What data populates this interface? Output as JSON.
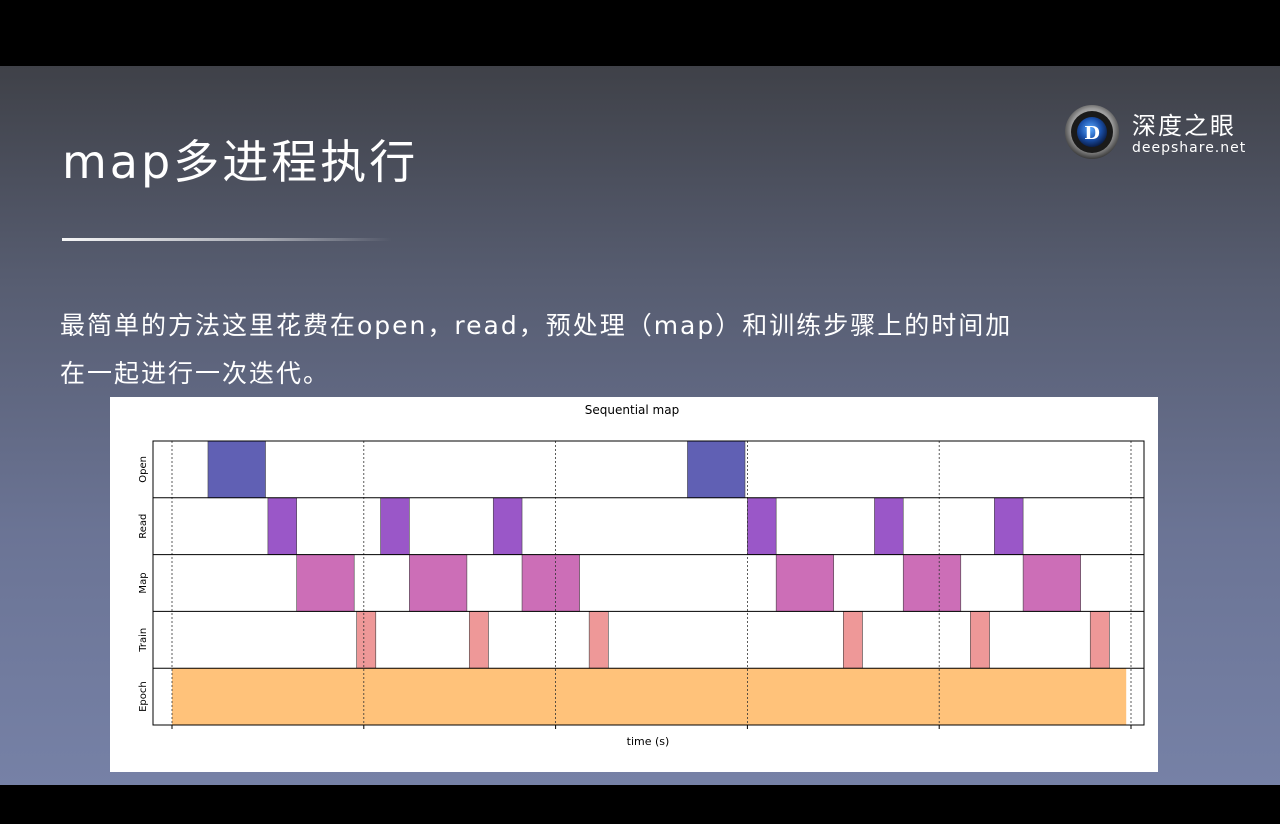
{
  "slide": {
    "title": "map多进程执行",
    "paragraph_line1": "最简单的方法这里花费在open，read，预处理（map）和训练步骤上的时间加",
    "paragraph_line2": "在一起进行一次迭代。"
  },
  "logo": {
    "name_cn": "深度之眼",
    "name_en": "deepshare.net",
    "mark_letter": "D"
  },
  "colors": {
    "open": "#6060b4",
    "read": "#9a57c8",
    "map": "#cc6eb7",
    "train": "#ee9898",
    "epoch": "#ffc27a"
  },
  "chart_data": {
    "type": "timeline",
    "title": "Sequential map",
    "xlabel": "time (s)",
    "ylabel": "",
    "rows": [
      "Open",
      "Read",
      "Map",
      "Train",
      "Epoch"
    ],
    "xlim": [
      0,
      20.3
    ],
    "gridlines": [
      0,
      4,
      8,
      12,
      16,
      20
    ],
    "series": [
      {
        "row": "Open",
        "color_key": "open",
        "intervals": [
          [
            0.75,
            1.95
          ],
          [
            10.75,
            11.95
          ]
        ]
      },
      {
        "row": "Read",
        "color_key": "read",
        "intervals": [
          [
            2.0,
            2.6
          ],
          [
            4.35,
            4.95
          ],
          [
            6.7,
            7.3
          ],
          [
            12.0,
            12.6
          ],
          [
            14.65,
            15.25
          ],
          [
            17.15,
            17.75
          ]
        ]
      },
      {
        "row": "Map",
        "color_key": "map",
        "intervals": [
          [
            2.6,
            3.8
          ],
          [
            4.95,
            6.15
          ],
          [
            7.3,
            8.5
          ],
          [
            12.6,
            13.8
          ],
          [
            15.25,
            16.45
          ],
          [
            17.75,
            18.95
          ]
        ]
      },
      {
        "row": "Train",
        "color_key": "train",
        "intervals": [
          [
            3.85,
            4.25
          ],
          [
            6.2,
            6.6
          ],
          [
            8.7,
            9.1
          ],
          [
            14.0,
            14.4
          ],
          [
            16.65,
            17.05
          ],
          [
            19.15,
            19.55
          ]
        ]
      },
      {
        "row": "Epoch",
        "color_key": "epoch",
        "intervals": [
          [
            0,
            19.9
          ]
        ]
      }
    ]
  }
}
